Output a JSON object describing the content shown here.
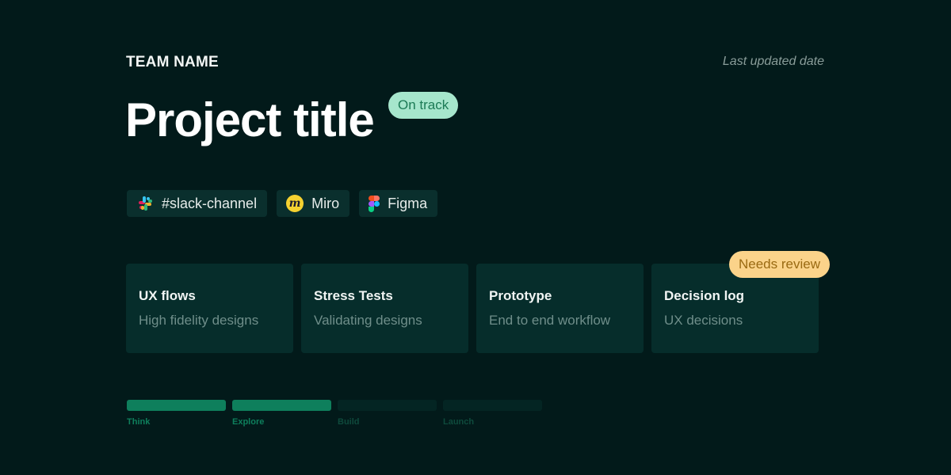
{
  "header": {
    "team_name": "TEAM NAME",
    "last_updated": "Last updated date",
    "project_title": "Project title",
    "status_badge": "On track"
  },
  "links": [
    {
      "label": "#slack-channel",
      "icon": "slack-icon"
    },
    {
      "label": "Miro",
      "icon": "miro-icon",
      "icon_glyph": "m"
    },
    {
      "label": "Figma",
      "icon": "figma-icon"
    }
  ],
  "cards": [
    {
      "title": "UX flows",
      "subtitle": "High fidelity designs"
    },
    {
      "title": "Stress Tests",
      "subtitle": "Validating designs"
    },
    {
      "title": "Prototype",
      "subtitle": "End to end workflow"
    },
    {
      "title": "Decision log",
      "subtitle": "UX decisions",
      "badge": "Needs review"
    }
  ],
  "progress": {
    "steps": [
      {
        "label": "Think",
        "complete": true
      },
      {
        "label": "Explore",
        "complete": true
      },
      {
        "label": "Build",
        "complete": false
      },
      {
        "label": "Launch",
        "complete": false
      }
    ],
    "completed_steps": 2,
    "total_steps": 4
  },
  "colors": {
    "background": "#021a1a",
    "on_track_bg": "#a6e6cc",
    "on_track_text": "#1b7a55",
    "needs_review_bg": "#fbd38a",
    "needs_review_text": "#9a6a12",
    "progress_complete": "#0e7f5c"
  }
}
